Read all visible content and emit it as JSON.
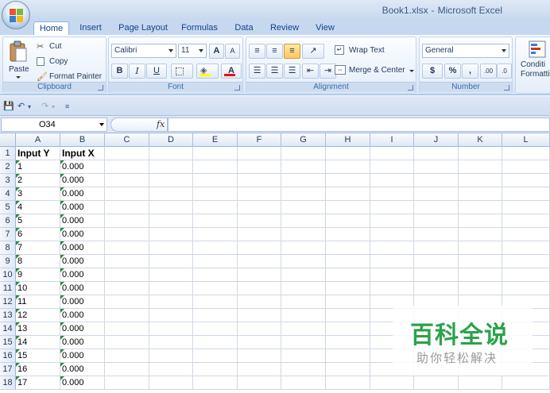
{
  "window": {
    "file_name": "Book1.xlsx",
    "separator": "-",
    "app_name": "Microsoft Excel"
  },
  "tabs": [
    "Home",
    "Insert",
    "Page Layout",
    "Formulas",
    "Data",
    "Review",
    "View"
  ],
  "active_tab": "Home",
  "ribbon": {
    "clipboard": {
      "label": "Clipboard",
      "paste": "Paste",
      "cut": "Cut",
      "copy": "Copy",
      "format_painter": "Format Painter"
    },
    "font": {
      "label": "Font",
      "font_name": "Calibri",
      "font_size": "11",
      "bold": "B",
      "italic": "I",
      "underline": "U",
      "grow": "A",
      "shrink": "A",
      "font_color": "A"
    },
    "alignment": {
      "label": "Alignment",
      "wrap_text": "Wrap Text",
      "merge_center": "Merge & Center"
    },
    "number": {
      "label": "Number",
      "format": "General",
      "currency": "$",
      "percent": "%",
      "comma": ",",
      "inc_decimal": ".00",
      "dec_decimal": ".0"
    },
    "styles": {
      "conditional_line1": "Conditi",
      "conditional_line2": "Formatti"
    }
  },
  "formula_bar": {
    "name_box": "O34",
    "fx": "fx",
    "value": ""
  },
  "grid": {
    "columns": [
      "A",
      "B",
      "C",
      "D",
      "E",
      "F",
      "G",
      "H",
      "I",
      "J",
      "K",
      "L"
    ],
    "rows": [
      {
        "n": "1",
        "a": "Input Y",
        "b": "Input X"
      },
      {
        "n": "2",
        "a": "1",
        "b": "0.000"
      },
      {
        "n": "3",
        "a": "2",
        "b": "0.000"
      },
      {
        "n": "4",
        "a": "3",
        "b": "0.000"
      },
      {
        "n": "5",
        "a": "4",
        "b": "0.000"
      },
      {
        "n": "6",
        "a": "5",
        "b": "0.000"
      },
      {
        "n": "7",
        "a": "6",
        "b": "0.000"
      },
      {
        "n": "8",
        "a": "7",
        "b": "0.000"
      },
      {
        "n": "9",
        "a": "8",
        "b": "0.000"
      },
      {
        "n": "10",
        "a": "9",
        "b": "0.000"
      },
      {
        "n": "11",
        "a": "10",
        "b": "0.000"
      },
      {
        "n": "12",
        "a": "11",
        "b": "0.000"
      },
      {
        "n": "13",
        "a": "12",
        "b": "0.000"
      },
      {
        "n": "14",
        "a": "13",
        "b": "0.000"
      },
      {
        "n": "15",
        "a": "14",
        "b": "0.000"
      },
      {
        "n": "16",
        "a": "15",
        "b": "0.000"
      },
      {
        "n": "17",
        "a": "16",
        "b": "0.000"
      },
      {
        "n": "18",
        "a": "17",
        "b": "0.000"
      }
    ]
  },
  "watermark": {
    "title": "百科全说",
    "subtitle": "助你轻松解决"
  },
  "colors": {
    "ribbon_bg": "#dfe9f5",
    "tab_text": "#15428b",
    "error_indicator": "#2c8c3c",
    "watermark_green": "#2aa34a"
  }
}
